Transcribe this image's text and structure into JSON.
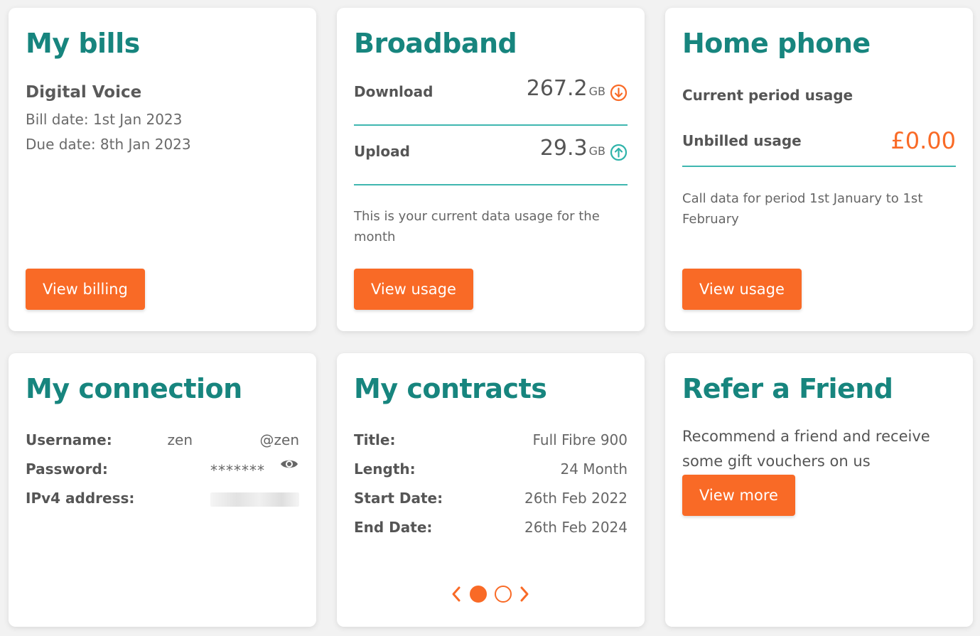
{
  "bills": {
    "title": "My bills",
    "product": "Digital Voice",
    "bill_date": "Bill date: 1st Jan 2023",
    "due_date": "Due date: 8th Jan 2023",
    "button": "View billing"
  },
  "broadband": {
    "title": "Broadband",
    "download_label": "Download",
    "download_value": "267.2",
    "download_unit": "GB",
    "upload_label": "Upload",
    "upload_value": "29.3",
    "upload_unit": "GB",
    "note": "This is your current data usage for the month",
    "button": "View usage",
    "download_icon": "arrow-down-circle-icon",
    "upload_icon": "arrow-up-circle-icon"
  },
  "home_phone": {
    "title": "Home phone",
    "current_label": "Current period usage",
    "unbilled_label": "Unbilled usage",
    "unbilled_amount": "£0.00",
    "note": "Call data for period 1st January to 1st February",
    "button": "View usage"
  },
  "connection": {
    "title": "My connection",
    "username_label": "Username:",
    "username_prefix": "zen",
    "username_suffix": "@zen",
    "password_label": "Password:",
    "password_value": "*******",
    "ipv4_label": "IPv4 address:",
    "eye_icon": "eye-icon"
  },
  "contracts": {
    "title": "My contracts",
    "rows": [
      {
        "label": "Title:",
        "value": "Full Fibre 900"
      },
      {
        "label": "Length:",
        "value": "24 Month"
      },
      {
        "label": "Start Date:",
        "value": "26th Feb 2022"
      },
      {
        "label": "End Date:",
        "value": "26th Feb 2024"
      }
    ],
    "carousel": {
      "pages": 2,
      "active": 1
    }
  },
  "refer": {
    "title": "Refer a Friend",
    "text": "Recommend a friend and receive some gift vouchers on us",
    "button": "View more"
  },
  "colors": {
    "teal": "#17857e",
    "divider": "#3fb7b0",
    "orange": "#f96a26",
    "card_bg": "#ffffff",
    "page_bg": "#f2f2f2"
  }
}
